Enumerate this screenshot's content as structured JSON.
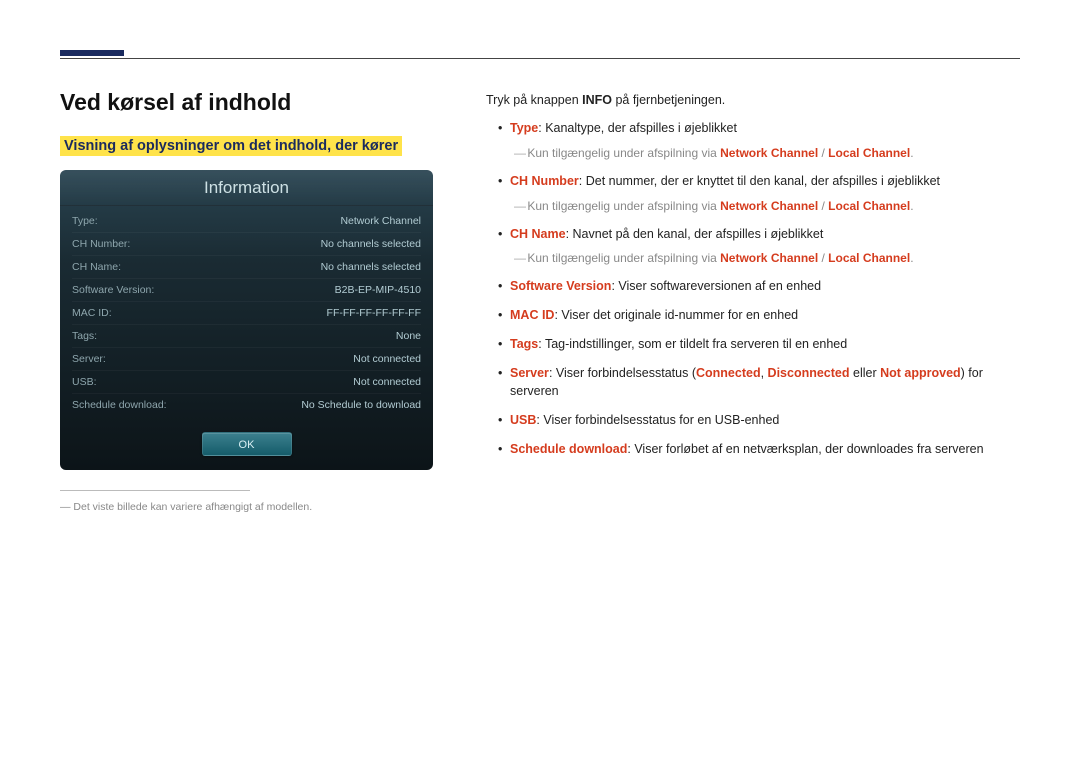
{
  "heading": "Ved kørsel af indhold",
  "subheading": "Visning af oplysninger om det indhold, der kører",
  "info_panel": {
    "title": "Information",
    "rows": [
      {
        "label": "Type:",
        "value": "Network Channel"
      },
      {
        "label": "CH Number:",
        "value": "No channels selected"
      },
      {
        "label": "CH Name:",
        "value": "No channels selected"
      },
      {
        "label": "Software Version:",
        "value": "B2B-EP-MIP-4510"
      },
      {
        "label": "MAC ID:",
        "value": "FF-FF-FF-FF-FF-FF"
      },
      {
        "label": "Tags:",
        "value": "None"
      },
      {
        "label": "Server:",
        "value": "Not connected"
      },
      {
        "label": "USB:",
        "value": "Not connected"
      },
      {
        "label": "Schedule download:",
        "value": "No Schedule to download"
      }
    ],
    "ok": "OK"
  },
  "footnote": "Det viste billede kan variere afhængigt af modellen.",
  "intro": {
    "pre": "Tryk på knappen ",
    "bold": "INFO",
    "post": " på fjernbetjeningen."
  },
  "bullets": {
    "type": {
      "key": "Type",
      "text": ": Kanaltype, der afspilles i øjeblikket"
    },
    "avail": {
      "pre": "Kun tilgængelig under afspilning via ",
      "a": "Network Channel",
      "sep": " / ",
      "b": "Local Channel",
      "end": "."
    },
    "chnum": {
      "key": "CH Number",
      "text": ": Det nummer, der er knyttet til den kanal, der afspilles i øjeblikket"
    },
    "chname": {
      "key": "CH Name",
      "text": ": Navnet på den kanal, der afspilles i øjeblikket"
    },
    "sw": {
      "key": "Software Version",
      "text": ": Viser softwareversionen af en enhed"
    },
    "mac": {
      "key": "MAC ID",
      "text": ": Viser det originale id-nummer for en enhed"
    },
    "tags": {
      "key": "Tags",
      "text": ": Tag-indstillinger, som er tildelt fra serveren til en enhed"
    },
    "server": {
      "key": "Server",
      "pre": ": Viser forbindelsesstatus (",
      "a": "Connected",
      "c1": ", ",
      "b": "Disconnected",
      "mid": " eller ",
      "c": "Not approved",
      "post": ") for serveren"
    },
    "usb": {
      "key": "USB",
      "text": ": Viser forbindelsesstatus for en USB-enhed"
    },
    "sched": {
      "key": "Schedule download",
      "text": ": Viser forløbet af en netværksplan, der downloades fra serveren"
    }
  }
}
